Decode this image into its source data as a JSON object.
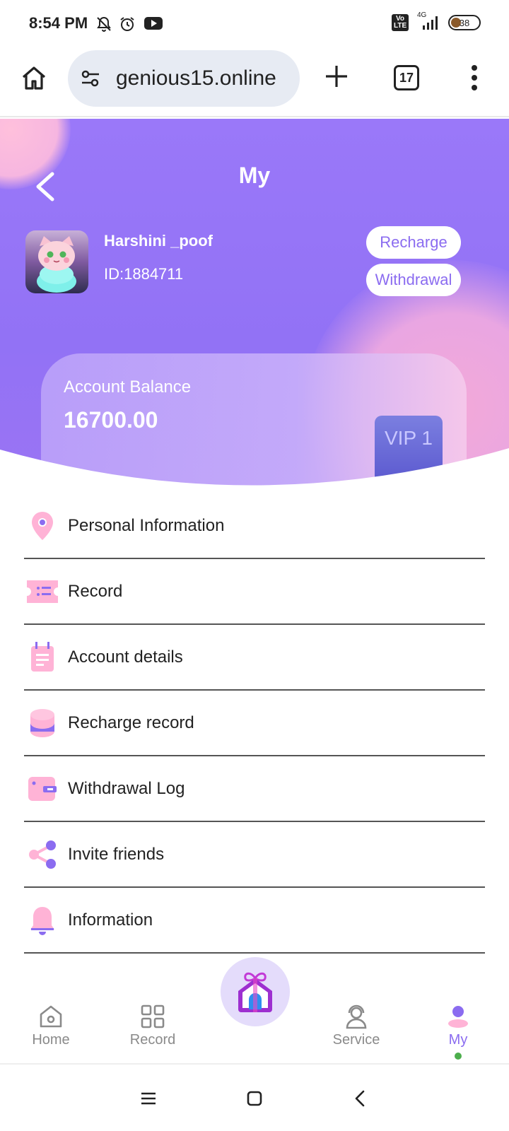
{
  "status_bar": {
    "time": "8:54 PM",
    "icons": [
      "mute-icon",
      "alarm-icon",
      "youtube-icon"
    ],
    "network_badge": "Vo LTE",
    "network_type": "4G",
    "battery": "38",
    "battery_level": 0.38
  },
  "browser": {
    "url": "genious15.online",
    "tab_count": "17",
    "icons": [
      "home-icon",
      "site-settings-icon",
      "new-tab-icon",
      "more-icon"
    ]
  },
  "header": {
    "title": "My",
    "username": "Harshini _poof",
    "user_id": "ID:1884711",
    "recharge_label": "Recharge",
    "withdrawal_label": "Withdrawal",
    "colors": {
      "primary": "#9a78f9",
      "accent": "#8b6cf0",
      "pink": "#f3a9d8"
    }
  },
  "balance": {
    "label": "Account Balance",
    "value": "16700.00",
    "vip": "VIP 1"
  },
  "menu": {
    "items": [
      {
        "label": "Personal Information",
        "icon": "location-pin-icon"
      },
      {
        "label": "Record",
        "icon": "ticket-list-icon"
      },
      {
        "label": "Account details",
        "icon": "notepad-icon"
      },
      {
        "label": "Recharge record",
        "icon": "coin-stack-icon"
      },
      {
        "label": "Withdrawal Log",
        "icon": "wallet-icon"
      },
      {
        "label": "Invite friends",
        "icon": "share-icon"
      },
      {
        "label": "Information",
        "icon": "bell-icon"
      }
    ]
  },
  "bottom_nav": {
    "items": [
      {
        "label": "Home",
        "icon": "home-icon"
      },
      {
        "label": "Record",
        "icon": "grid-icon"
      },
      {
        "label": "",
        "icon": "gift-house-icon"
      },
      {
        "label": "Service",
        "icon": "support-agent-icon"
      },
      {
        "label": "My",
        "icon": "user-icon",
        "active": true
      }
    ]
  },
  "system_nav": {
    "icons": [
      "menu-icon",
      "square-home-icon",
      "back-icon"
    ]
  }
}
